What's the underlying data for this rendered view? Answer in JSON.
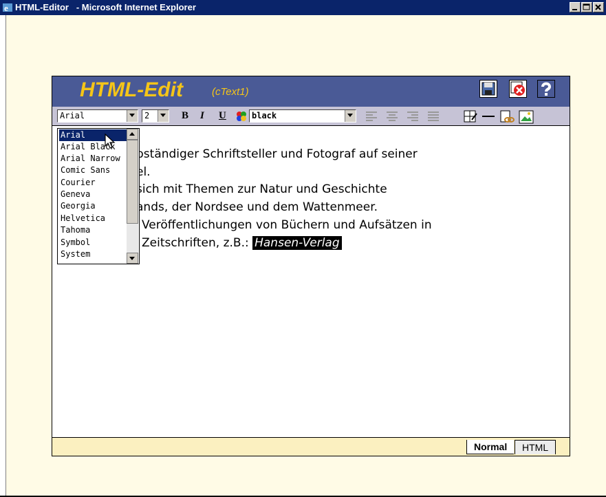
{
  "window": {
    "title": "HTML-Editor   - Microsoft Internet Explorer"
  },
  "editor": {
    "title": "HTML-Edit",
    "subtitle": "(cText1)",
    "toolbar": {
      "font_value": "Arial",
      "size_value": "2",
      "bold_label": "B",
      "italic_label": "I",
      "underline_label": "U",
      "color_value": "black"
    },
    "content": {
      "lines": [
        "bständiger Schriftsteller und Fotograf auf seiner",
        "el.",
        "sich mit Themen zur Natur und Geschichte",
        "ands, der Nordsee und dem Wattenmeer.",
        "Veröffentlichungen von Büchern und Aufsätzen in",
        "Zeitschriften, z.B.: "
      ],
      "highlight": "Hansen-Verlag"
    },
    "tabs": {
      "normal": "Normal",
      "html": "HTML"
    },
    "font_list": [
      "Arial",
      "Arial Black",
      "Arial Narrow",
      "Comic Sans",
      "Courier",
      "Geneva",
      "Georgia",
      "Helvetica",
      "Tahoma",
      "Symbol",
      "System"
    ]
  },
  "icons": [
    "ie-icon",
    "minimize-icon",
    "maximize-icon",
    "close-icon",
    "save-icon",
    "cancel-icon",
    "help-icon",
    "color-palette-icon",
    "align-left-icon",
    "align-center-icon",
    "align-right-icon",
    "justify-icon",
    "table-icon",
    "horizontal-rule-icon",
    "link-icon",
    "image-icon",
    "mouse-cursor-icon"
  ],
  "colors": {
    "titlebar": "#0a246a",
    "header": "#4a5a96",
    "accent": "#f5c518",
    "page": "#fffbe6"
  }
}
